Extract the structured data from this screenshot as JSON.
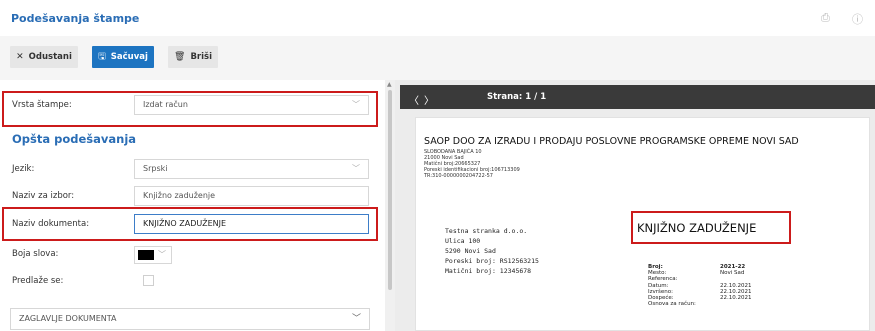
{
  "header": {
    "title": "Podešavanja štampe",
    "icons": [
      "printer-icon",
      "info-icon"
    ]
  },
  "toolbar": {
    "cancel_label": "Odustani",
    "save_label": "Sačuvaj",
    "delete_label": "Briši",
    "icons": {
      "cancel": "✕",
      "save": "🖫",
      "delete": "🗑"
    }
  },
  "form": {
    "print_type": {
      "label": "Vrsta štampe:",
      "value": "Izdat račun"
    },
    "section_title": "Opšta podešavanja",
    "language": {
      "label": "Jezik:",
      "value": "Srpski"
    },
    "name_choice": {
      "label": "Naziv za izbor:",
      "value": "Knjižno zaduženje"
    },
    "document_name": {
      "label": "Naziv dokumenta:",
      "value": "KNJIŽNO ZADUŽENJE"
    },
    "font_color": {
      "label": "Boja slova:",
      "value": "#000000"
    },
    "suggested": {
      "label": "Predlaže se:",
      "checked": false
    },
    "header_section": "ZAGLAVLJE DOKUMENTA"
  },
  "viewer": {
    "page_indicator": "Strana: 1 / 1"
  },
  "document": {
    "company_name": "SAOP DOO ZA IZRADU I PRODAJU POSLOVNE PROGRAMSKE OPREME  NOVI SAD",
    "company_lines": [
      "SLOBODANA BAJIĆA 10",
      "21000 Novi Sad",
      "Matični broj:20665327",
      "Poreski identifikacioni broj:106713309",
      "TR:310-0000000204722-57"
    ],
    "recipient_lines": [
      "Testna stranka d.o.o.",
      "Ulica 100",
      "5290    Novi Sad",
      "Poreski broj: RS12563215",
      "Matični broj: 12345678"
    ],
    "title": "KNJIŽNO ZADUŽENJE",
    "meta_labels": [
      "Broj:",
      "Mesto:",
      "Referenca:",
      "Datum:",
      "Izvršeno:",
      "Dospeće:",
      "Osnova za račun:"
    ],
    "meta_values": [
      "2021-22",
      "Novi Sad",
      "",
      "22.10.2021",
      "22.10.2021",
      "22.10.2021",
      ""
    ]
  },
  "colors": {
    "accent": "#2a6db5",
    "primary_button": "#1d74c1",
    "highlight": "#cc1b1b"
  }
}
